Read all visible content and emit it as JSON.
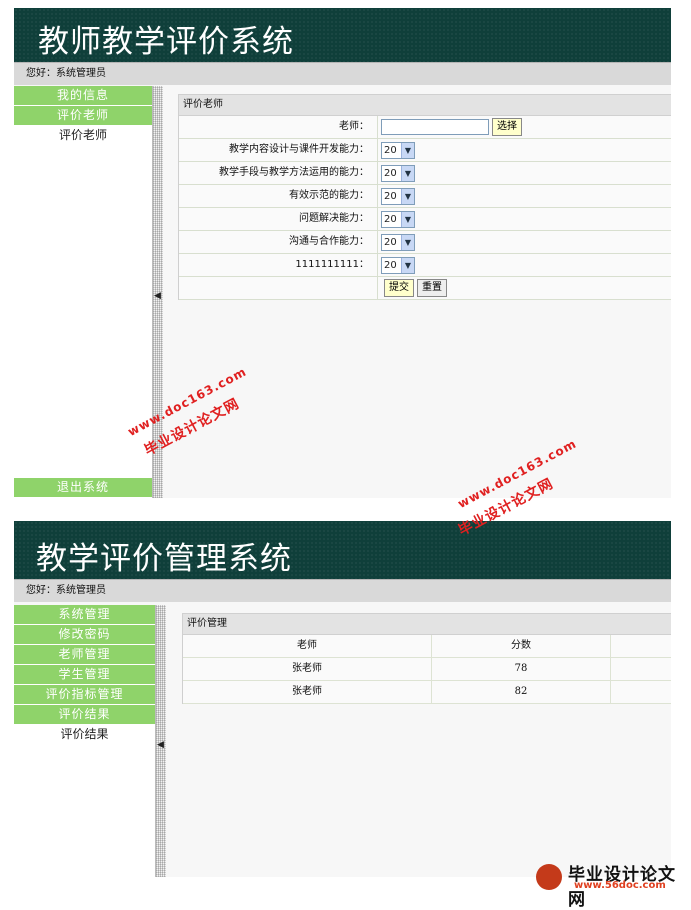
{
  "screen1": {
    "title": "教师教学评价系统",
    "greeting": "您好：系统管理员",
    "menu": [
      {
        "label": "我的信息"
      },
      {
        "label": "评价老师"
      }
    ],
    "submenu": "评价老师",
    "exit": "退出系统",
    "section_title": "评价老师",
    "teacher_label": "老师：",
    "teacher_value": "",
    "select_button": "选择",
    "criteria": [
      {
        "label": "教学内容设计与课件开发能力：",
        "value": "20"
      },
      {
        "label": "教学手段与教学方法运用的能力：",
        "value": "20"
      },
      {
        "label": "有效示范的能力：",
        "value": "20"
      },
      {
        "label": "问题解决能力：",
        "value": "20"
      },
      {
        "label": "沟通与合作能力：",
        "value": "20"
      },
      {
        "label": "1111111111：",
        "value": "20"
      }
    ],
    "submit": "提交",
    "reset": "重置"
  },
  "screen2": {
    "title": "教学评价管理系统",
    "greeting": "您好：系统管理员",
    "menu": [
      {
        "label": "系统管理"
      },
      {
        "label": "修改密码"
      },
      {
        "label": "老师管理"
      },
      {
        "label": "学生管理"
      },
      {
        "label": "评价指标管理"
      },
      {
        "label": "评价结果"
      }
    ],
    "submenu": "评价结果",
    "section_title": "评价管理",
    "columns": [
      "老师",
      "分数"
    ],
    "rows": [
      {
        "teacher": "张老师",
        "score": "78"
      },
      {
        "teacher": "张老师",
        "score": "82"
      }
    ]
  },
  "watermarks": {
    "site_cn": "毕业设计论文网",
    "site_url": "www.doc163.com",
    "logo_title": "毕业设计论文网",
    "logo_url": "www.56doc.com"
  },
  "colors": {
    "banner": "#0f3f3a",
    "menu_green": "#8fd36a",
    "watermark": "#e02020"
  }
}
